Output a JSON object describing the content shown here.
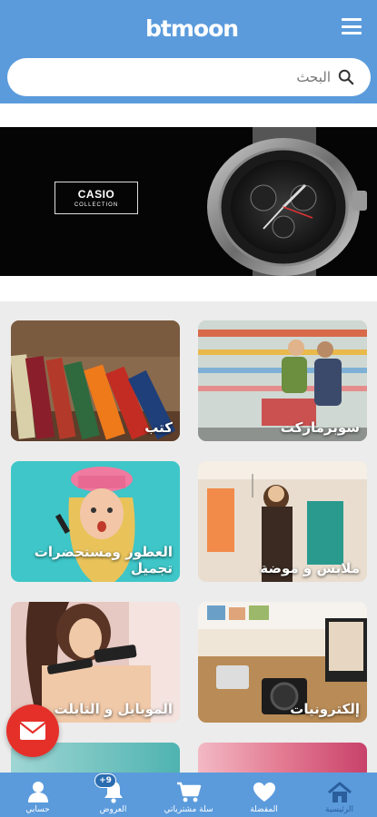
{
  "header": {
    "logo_text": "btmoon",
    "menu_icon": "hamburger-icon"
  },
  "search": {
    "placeholder": "البحث",
    "icon": "search-icon"
  },
  "banner": {
    "brand": "CASIO",
    "collection": "COLLECTION"
  },
  "categories": [
    {
      "label": "سوبرماركت"
    },
    {
      "label": "كتب"
    },
    {
      "label": "ملابس و موضة"
    },
    {
      "label": "العطور ومستحضرات تجميل"
    },
    {
      "label": "إلكترونيات"
    },
    {
      "label": "الموبايل و التابلت"
    }
  ],
  "fab": {
    "icon": "envelope-icon"
  },
  "nav": [
    {
      "label": "الرئيسية",
      "icon": "home-icon",
      "active": true
    },
    {
      "label": "المفضلة",
      "icon": "heart-icon"
    },
    {
      "label": "سلة مشترياتي",
      "icon": "cart-icon"
    },
    {
      "label": "العروض",
      "icon": "bell-icon",
      "badge": "9+"
    },
    {
      "label": "حسابي",
      "icon": "user-icon"
    }
  ]
}
